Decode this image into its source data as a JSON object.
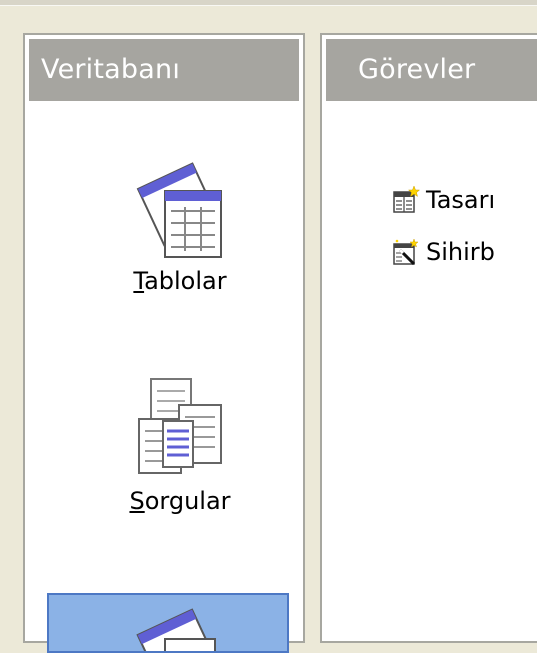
{
  "left_panel": {
    "title": "Veritabanı",
    "items": [
      {
        "mnemonic": "T",
        "rest": "ablolar",
        "icon": "tables-icon",
        "selected": false
      },
      {
        "mnemonic": "S",
        "rest": "orgular",
        "icon": "queries-icon",
        "selected": false
      },
      {
        "icon": "forms-icon",
        "selected": true
      }
    ]
  },
  "right_panel": {
    "title": "Görevler",
    "tasks": [
      {
        "label": "Tasarı",
        "icon": "design-view-icon"
      },
      {
        "label": "Sihirb",
        "icon": "wizard-icon"
      }
    ]
  },
  "colors": {
    "header_bg": "#a6a5a0",
    "selection_bg": "#8bb2e6",
    "selection_border": "#4d78c4",
    "icon_blue": "#5f5fd4"
  }
}
